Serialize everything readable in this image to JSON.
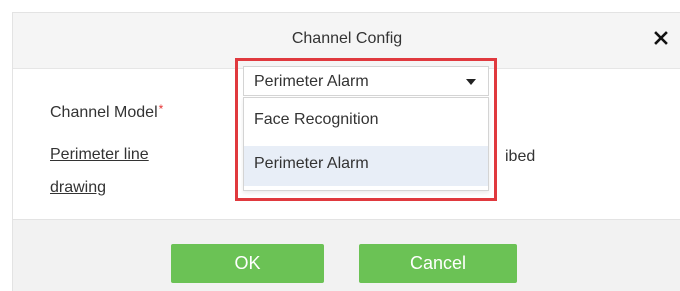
{
  "dialog": {
    "title": "Channel Config"
  },
  "form": {
    "channel_model_label": "Channel Model",
    "required_mark": "*",
    "perimeter_link_line1": "Perimeter line",
    "perimeter_link_line2": "drawing",
    "trailing_text": "ibed"
  },
  "select": {
    "value": "Perimeter Alarm",
    "options": [
      {
        "label": "Face Recognition",
        "selected": false
      },
      {
        "label": "Perimeter Alarm",
        "selected": true
      }
    ]
  },
  "buttons": {
    "ok": "OK",
    "cancel": "Cancel"
  },
  "colors": {
    "accent_green": "#6bc255",
    "highlight_red": "#e0393e",
    "required_red": "#e53333",
    "selected_option_bg": "#e8eef7"
  },
  "icons": {
    "close": "close-icon",
    "dropdown": "chevron-down-icon"
  }
}
